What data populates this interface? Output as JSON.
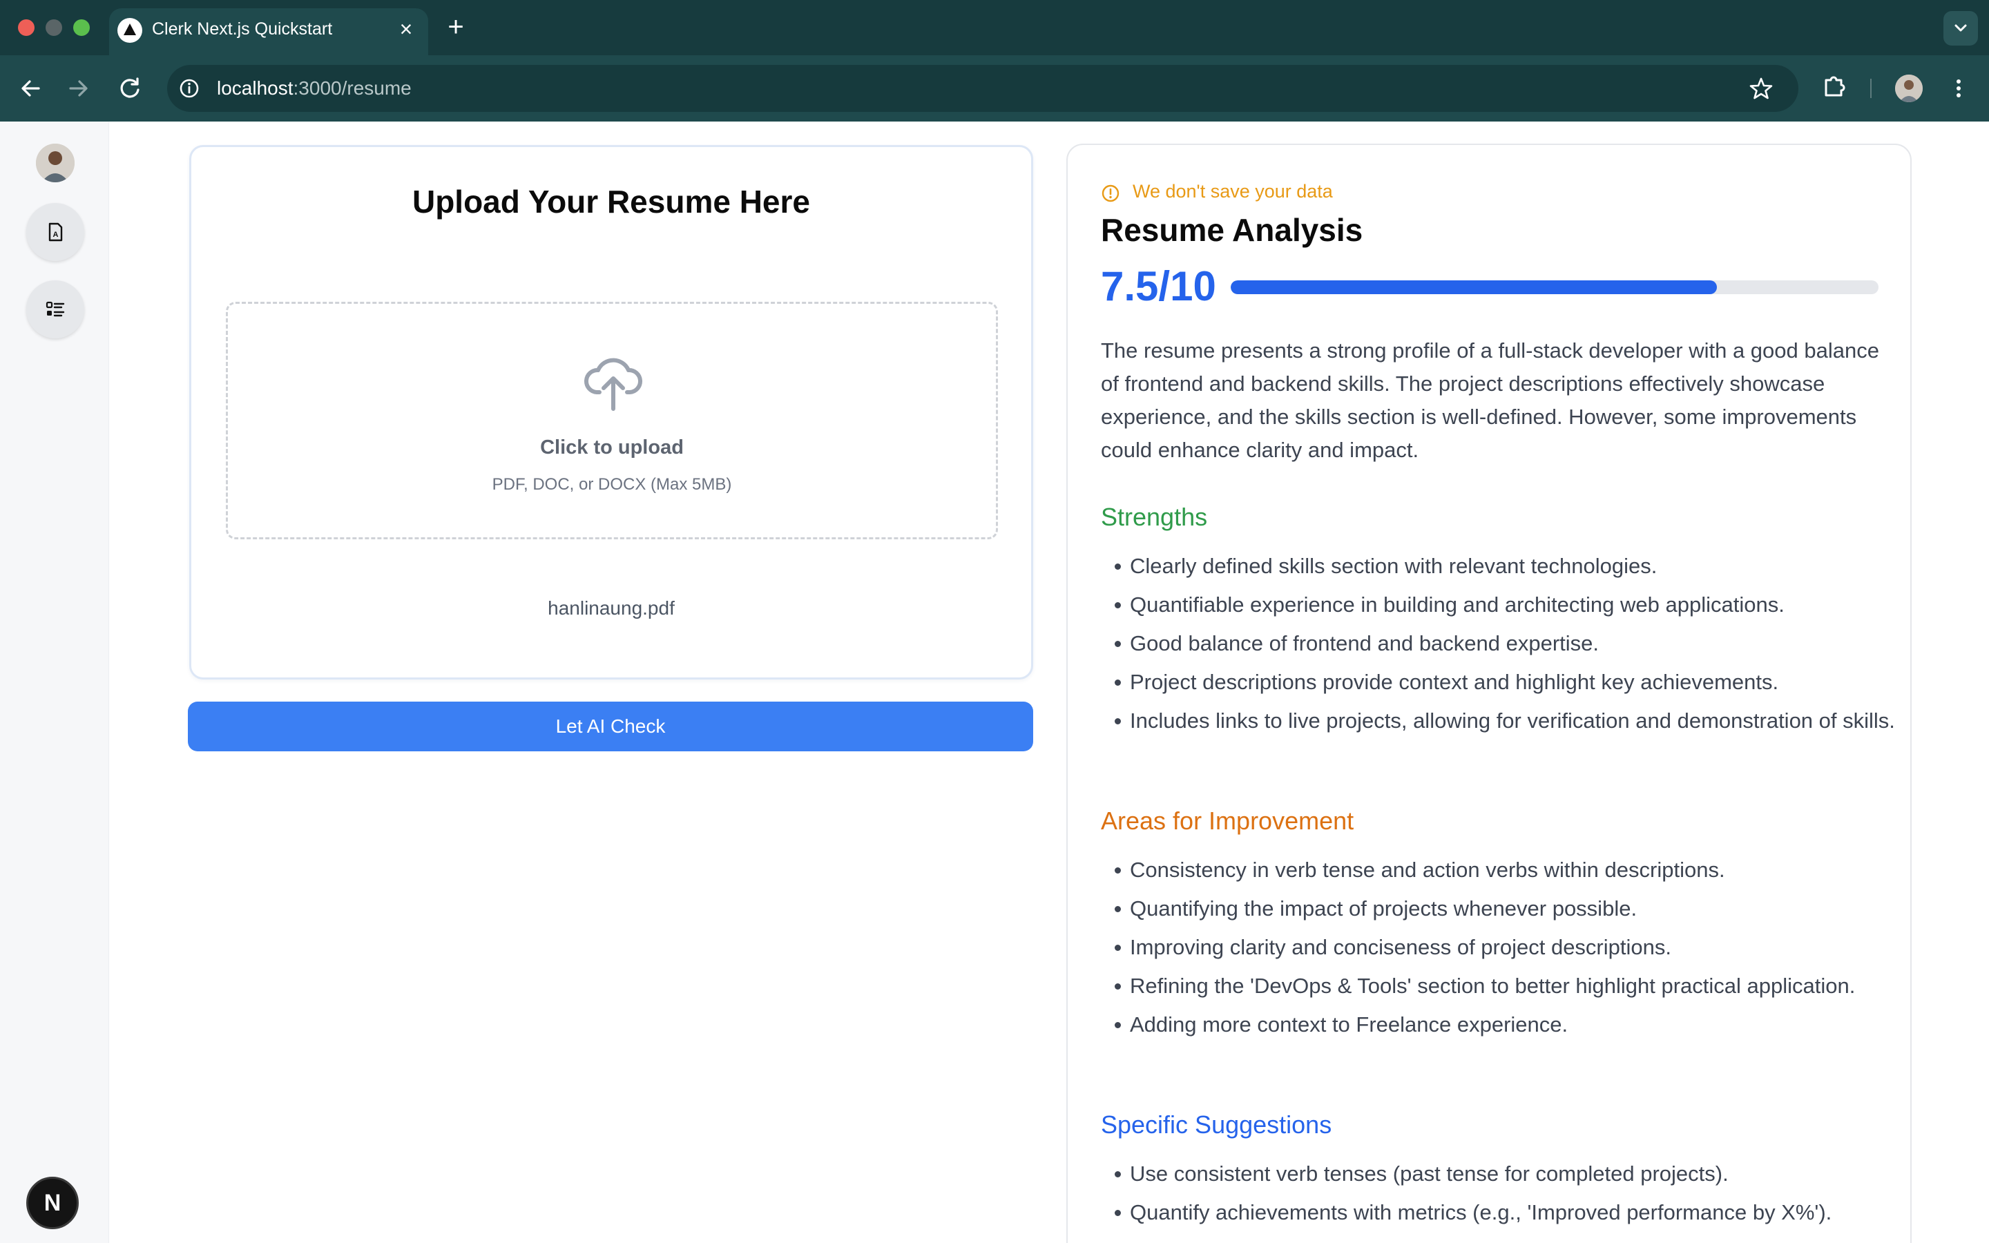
{
  "browser": {
    "tab_title": "Clerk Next.js Quickstart",
    "tab_close": "×",
    "new_tab": "+",
    "url_host": "localhost",
    "url_path": ":3000/resume"
  },
  "upload": {
    "title": "Upload Your Resume Here",
    "click_label": "Click to upload",
    "file_types": "PDF, DOC, or DOCX (Max 5MB)",
    "filename": "hanlinaung.pdf",
    "button_label": "Let AI Check"
  },
  "analysis": {
    "notice": "We don't save your data",
    "title": "Resume Analysis",
    "score_text": "7.5/10",
    "score_fraction": 0.75,
    "summary": "The resume presents a strong profile of a full-stack developer with a good balance of frontend and backend skills. The project descriptions effectively showcase experience, and the skills section is well-defined. However, some improvements could enhance clarity and impact.",
    "strengths_title": "Strengths",
    "strengths": [
      "Clearly defined skills section with relevant technologies.",
      "Quantifiable experience in building and architecting web applications.",
      "Good balance of frontend and backend expertise.",
      "Project descriptions provide context and highlight key achievements.",
      "Includes links to live projects, allowing for verification and demonstration of skills."
    ],
    "improvements_title": "Areas for Improvement",
    "improvements": [
      "Consistency in verb tense and action verbs within descriptions.",
      "Quantifying the impact of projects whenever possible.",
      "Improving clarity and conciseness of project descriptions.",
      "Refining the 'DevOps & Tools' section to better highlight practical application.",
      "Adding more context to Freelance experience."
    ],
    "suggestions_title": "Specific Suggestions",
    "suggestions": [
      "Use consistent verb tenses (past tense for completed projects).",
      "Quantify achievements with metrics (e.g., 'Improved performance by X%')."
    ]
  },
  "next_badge": "N",
  "colors": {
    "accent_blue": "#2563eb",
    "button_blue": "#3b7ff3",
    "strengths_green": "#2f9b4a",
    "improve_orange": "#dc7112",
    "notice_amber": "#e89a16"
  }
}
